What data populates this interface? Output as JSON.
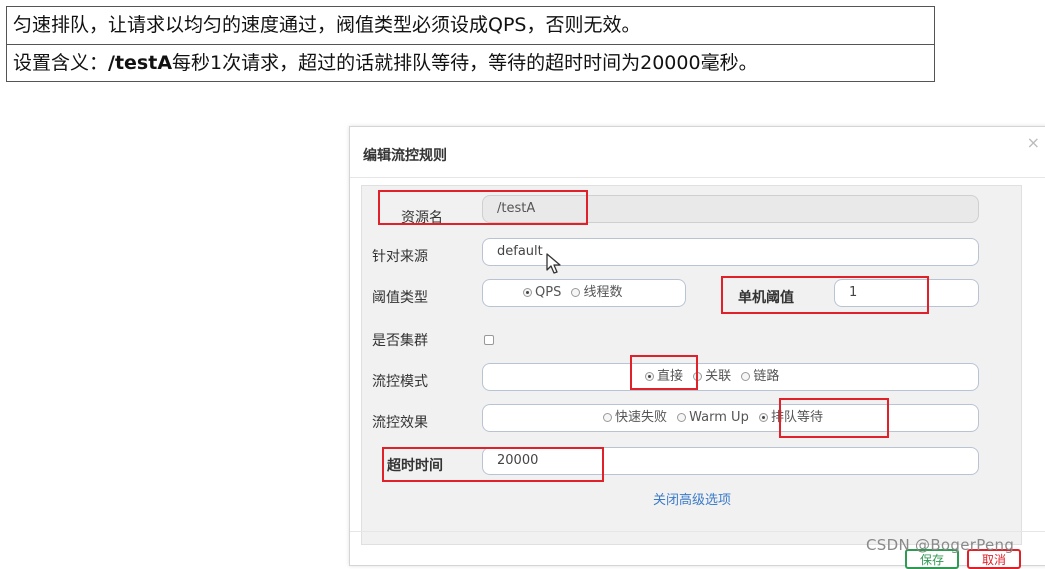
{
  "note": {
    "line1": "匀速排队，让请求以均匀的速度通过，阀值类型必须设成QPS，否则无效。",
    "line2_prefix": "设置含义：",
    "line2_path": "/testA",
    "line2_rest": "每秒1次请求，超过的话就排队等待，等待的超时时间为20000毫秒。"
  },
  "modal": {
    "title": "编辑流控规则",
    "close_glyph": "×",
    "labels": {
      "resource": "资源名",
      "origin": "针对来源",
      "threshold_type": "阈值类型",
      "single_threshold": "单机阈值",
      "cluster": "是否集群",
      "flow_mode": "流控模式",
      "flow_effect": "流控效果",
      "timeout": "超时时间"
    },
    "values": {
      "resource": "/testA",
      "origin": "default",
      "single_threshold": "1",
      "timeout": "20000"
    },
    "threshold_type_options": [
      "QPS",
      "线程数"
    ],
    "threshold_type_selected": "QPS",
    "flow_mode_options": [
      "直接",
      "关联",
      "链路"
    ],
    "flow_mode_selected": "直接",
    "flow_effect_options": [
      "快速失败",
      "Warm Up",
      "排队等待"
    ],
    "flow_effect_selected": "排队等待",
    "advanced_link": "关闭高级选项",
    "save_button": "保存",
    "cancel_button": "取消"
  },
  "watermark": "CSDN @BogerPeng",
  "colors": {
    "highlight": "#e0212a",
    "link": "#3a7ac9",
    "input_border": "#b8c4d4"
  }
}
